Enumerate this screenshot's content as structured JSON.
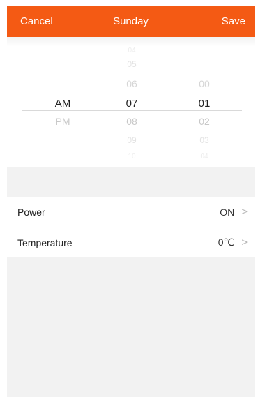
{
  "header": {
    "cancel_label": "Cancel",
    "title": "Sunday",
    "save_label": "Save",
    "background": "#f45a14"
  },
  "picker": {
    "ampm": {
      "items": [
        "AM",
        "PM"
      ],
      "selected": "AM"
    },
    "hour": {
      "items": [
        "04",
        "05",
        "06",
        "07",
        "08",
        "09",
        "10"
      ],
      "selected": "07"
    },
    "minute": {
      "items": [
        "00",
        "01",
        "02",
        "03",
        "04"
      ],
      "selected": "01"
    }
  },
  "settings": [
    {
      "label": "Power",
      "value": "ON",
      "chevron": ">"
    },
    {
      "label": "Temperature",
      "value": "0℃",
      "chevron": ">"
    }
  ]
}
